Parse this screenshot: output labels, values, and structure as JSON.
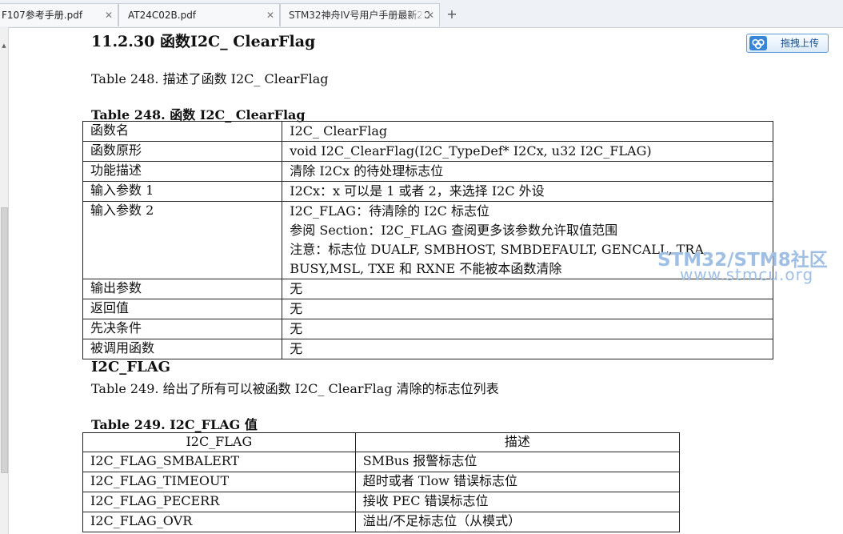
{
  "tabs": [
    {
      "label": "F107参考手册.pdf",
      "close": "✕"
    },
    {
      "label": "AT24C02B.pdf",
      "close": "✕"
    },
    {
      "label": "STM32神舟IV号用户手册最新2C",
      "close": "✕"
    }
  ],
  "new_tab_label": "+",
  "upload_button": {
    "label": "拖拽上传",
    "icon": "cloud-upload-icon",
    "color": "#5b9bd8"
  },
  "watermark": {
    "line1": "STM32/STM8社区",
    "line2": "www.stmcu.org",
    "color": "#9fbfe4"
  },
  "section": {
    "heading": "11.2.30  函数I2C_ ClearFlag",
    "intro": "Table 248.  描述了函数 I2C_ ClearFlag",
    "table_caption": "Table 248.  函数 I2C_ ClearFlag",
    "table_rows": [
      {
        "key": "函数名",
        "lines": [
          "I2C_ ClearFlag"
        ]
      },
      {
        "key": "函数原形",
        "lines": [
          "void I2C_ClearFlag(I2C_TypeDef* I2Cx, u32 I2C_FLAG)"
        ]
      },
      {
        "key": "功能描述",
        "lines": [
          "清除 I2Cx 的待处理标志位"
        ]
      },
      {
        "key": "输入参数 1",
        "lines": [
          "I2Cx：x 可以是 1 或者 2，来选择 I2C 外设"
        ]
      },
      {
        "key": "输入参数 2",
        "lines": [
          "I2C_FLAG：待清除的 I2C 标志位",
          "参阅 Section：I2C_FLAG 查阅更多该参数允许取值范围",
          "注意：标志位  DUALF,  SMBHOST,  SMBDEFAULT,  GENCALL,  TRA,",
          "BUSY,MSL, TXE 和 RXNE 不能被本函数清除"
        ]
      },
      {
        "key": "输出参数",
        "lines": [
          "无"
        ]
      },
      {
        "key": "返回值",
        "lines": [
          "无"
        ]
      },
      {
        "key": "先决条件",
        "lines": [
          "无"
        ]
      },
      {
        "key": "被调用函数",
        "lines": [
          "无"
        ]
      }
    ]
  },
  "flag_section": {
    "heading": "I2C_FLAG",
    "intro": "Table 249.  给出了所有可以被函数 I2C_ ClearFlag 清除的标志位列表",
    "table_caption": "Table 249. I2C_FLAG 值",
    "headers": [
      "I2C_FLAG",
      "描述"
    ],
    "rows": [
      [
        "I2C_FLAG_SMBALERT",
        "SMBus 报警标志位"
      ],
      [
        "I2C_FLAG_TIMEOUT",
        "超时或者 Tlow 错误标志位"
      ],
      [
        "I2C_FLAG_PECERR",
        "接收 PEC 错误标志位"
      ],
      [
        "I2C_FLAG_OVR",
        "溢出/不足标志位（从模式）"
      ]
    ]
  }
}
